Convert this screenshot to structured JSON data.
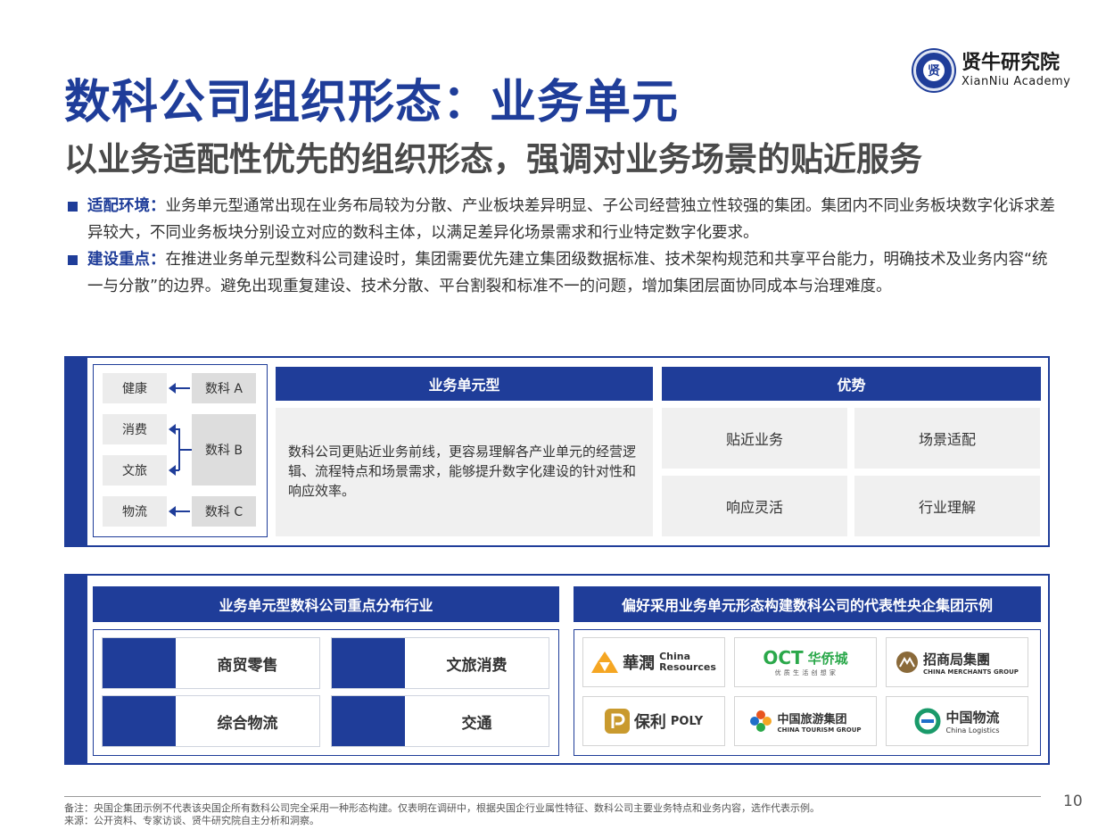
{
  "header": {
    "title": "数科公司组织形态：业务单元",
    "subtitle": "以业务适配性优先的组织形态，强调对业务场景的贴近服务"
  },
  "logo": {
    "name_cn": "贤牛研究院",
    "name_en": "XianNiu Academy",
    "badge_glyph": "贤"
  },
  "bullets": [
    {
      "key": "适配环境：",
      "text": "业务单元型通常出现在业务布局较为分散、产业板块差异明显、子公司经营独立性较强的集团。集团内不同业务板块数字化诉求差异较大，不同业务板块分别设立对应的数科主体，以满足差异化场景需求和行业特定数字化要求。"
    },
    {
      "key": "建设重点：",
      "text": "在推进业务单元型数科公司建设时，集团需要优先建立集团级数据标准、技术架构规范和共享平台能力，明确技术及业务内容“统一与分散”的边界。避免出现重复建设、技术分散、平台割裂和标准不一的问题，增加集团层面协同成本与治理难度。"
    }
  ],
  "structure": {
    "groups": [
      "健康",
      "消费",
      "文旅",
      "物流"
    ],
    "units": [
      "数科 A",
      "数科 B",
      "数科 C"
    ]
  },
  "type_panel": {
    "header": "业务单元型",
    "description": "数科公司更贴近业务前线，更容易理解各产业单元的经营逻辑、流程特点和场景需求，能够提升数字化建设的针对性和响应效率。"
  },
  "advantages": {
    "header": "优势",
    "items": [
      "贴近业务",
      "场景适配",
      "响应灵活",
      "行业理解"
    ]
  },
  "industries": {
    "header": "业务单元型数科公司重点分布行业",
    "items": [
      "商贸零售",
      "文旅消费",
      "综合物流",
      "交通"
    ]
  },
  "examples": {
    "header": "偏好采用业务单元形态构建数科公司的代表性央企集团示例",
    "logos": [
      {
        "mark": "華潤",
        "en1": "China",
        "en2": "Resources",
        "color": "#f5a623"
      },
      {
        "mark": "OCT",
        "cn": "华侨城",
        "sub": "优 质 生 活 创 想 家",
        "color": "#2aa84a"
      },
      {
        "mark": "招商局集團",
        "en": "CHINA MERCHANTS GROUP",
        "color": "#8a6a3a"
      },
      {
        "mark": "保利",
        "en": "POLY",
        "color": "#c99a2e"
      },
      {
        "cn": "中国旅游集团",
        "en": "CHINA TOURISM GROUP",
        "color": "#e8551f"
      },
      {
        "cn": "中国物流",
        "en": "China Logistics",
        "color": "#1a9a6a"
      }
    ]
  },
  "footer": {
    "note": "备注：央国企集团示例不代表该央国企所有数科公司完全采用一种形态构建。仅表明在调研中，根据央国企行业属性特征、数科公司主要业务特点和业务内容，选作代表示例。",
    "source": "来源：公开资料、专家访谈、贤牛研究院自主分析和洞察。",
    "page": "10"
  }
}
